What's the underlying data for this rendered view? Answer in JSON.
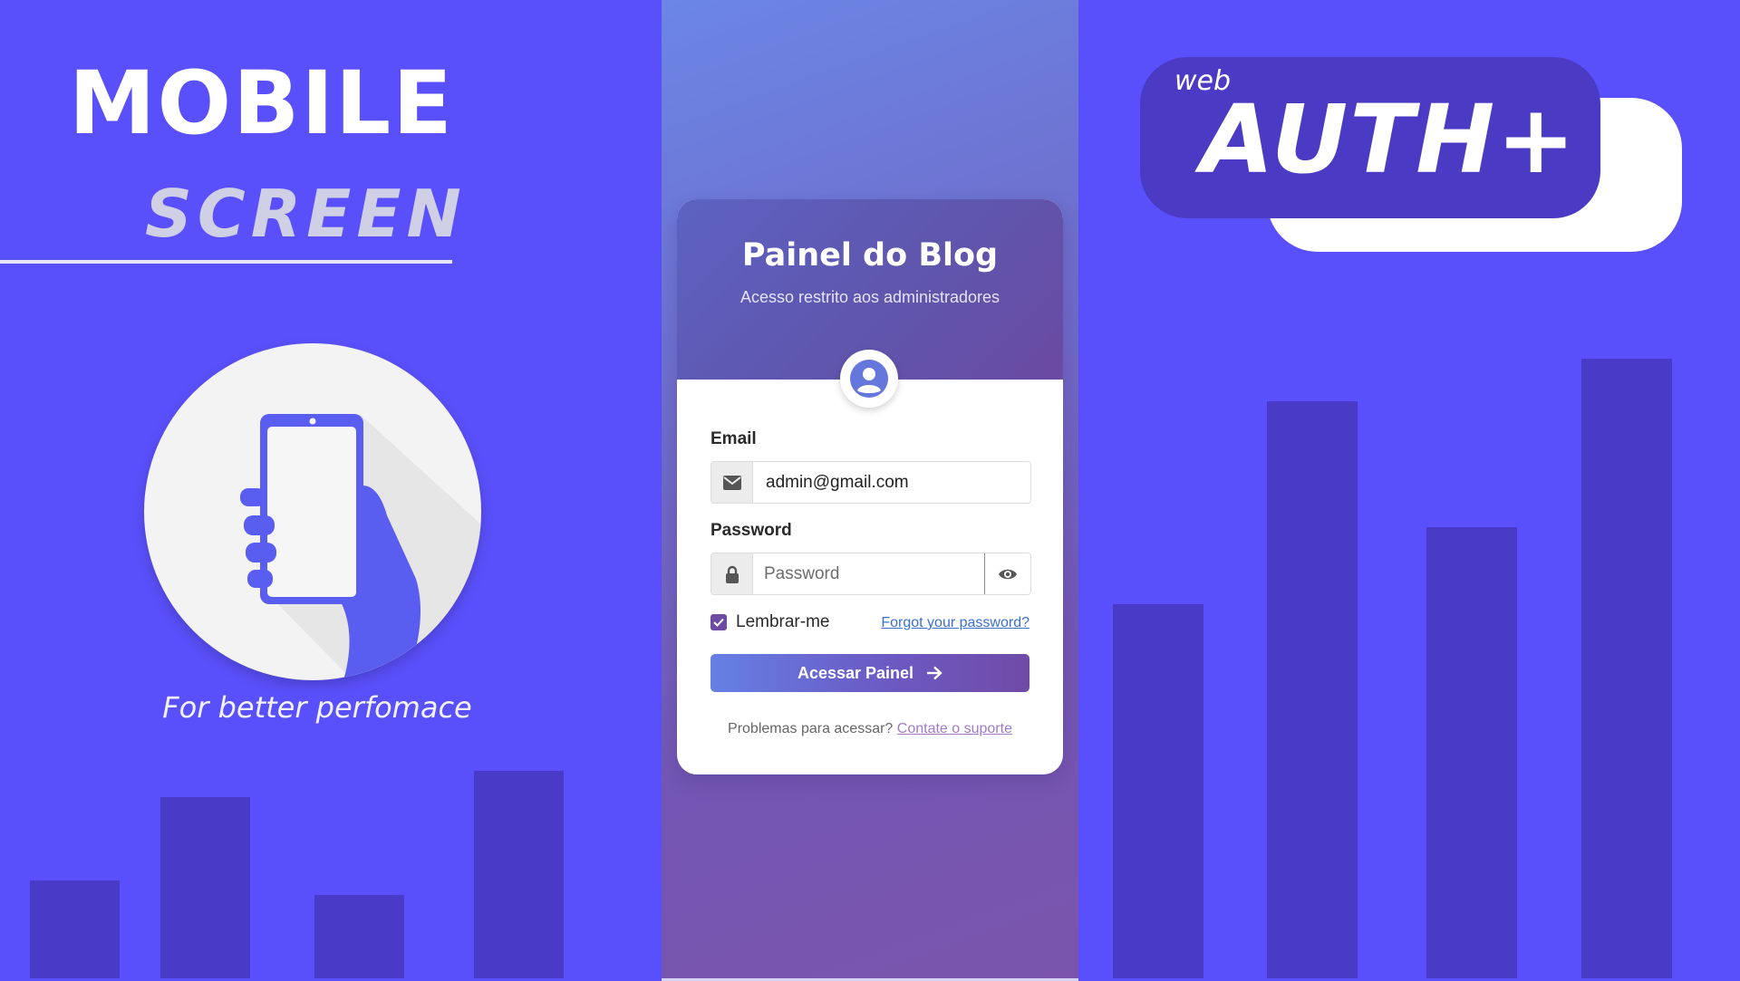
{
  "promo": {
    "title": "MOBILE",
    "subtitle": "SCREEN",
    "tagline": "For better perfomace"
  },
  "login": {
    "title": "Painel do Blog",
    "subtitle": "Acesso restrito aos administradores",
    "email_label": "Email",
    "email_value": "admin@gmail.com",
    "password_label": "Password",
    "password_placeholder": "Password",
    "remember_label": "Lembrar-me",
    "remember_checked": true,
    "forgot_link": "Forgot your password?",
    "submit_label": "Acessar Painel",
    "help_text": "Problemas para acessar?",
    "help_link": "Contate o suporte"
  },
  "brand": {
    "small": "web",
    "big": "AUTH+"
  },
  "icons": {
    "avatar": "user-circle-icon",
    "email": "envelope-icon",
    "password": "lock-icon",
    "toggle": "eye-icon",
    "submit": "arrow-right-icon",
    "promo": "hand-phone-icon"
  },
  "colors": {
    "background": "#5a50fb",
    "bars": "#4a3ac8",
    "brand_badge": "#4b3bc4",
    "accent_purple": "#6f4aa3",
    "link_blue": "#3b6fd6"
  }
}
